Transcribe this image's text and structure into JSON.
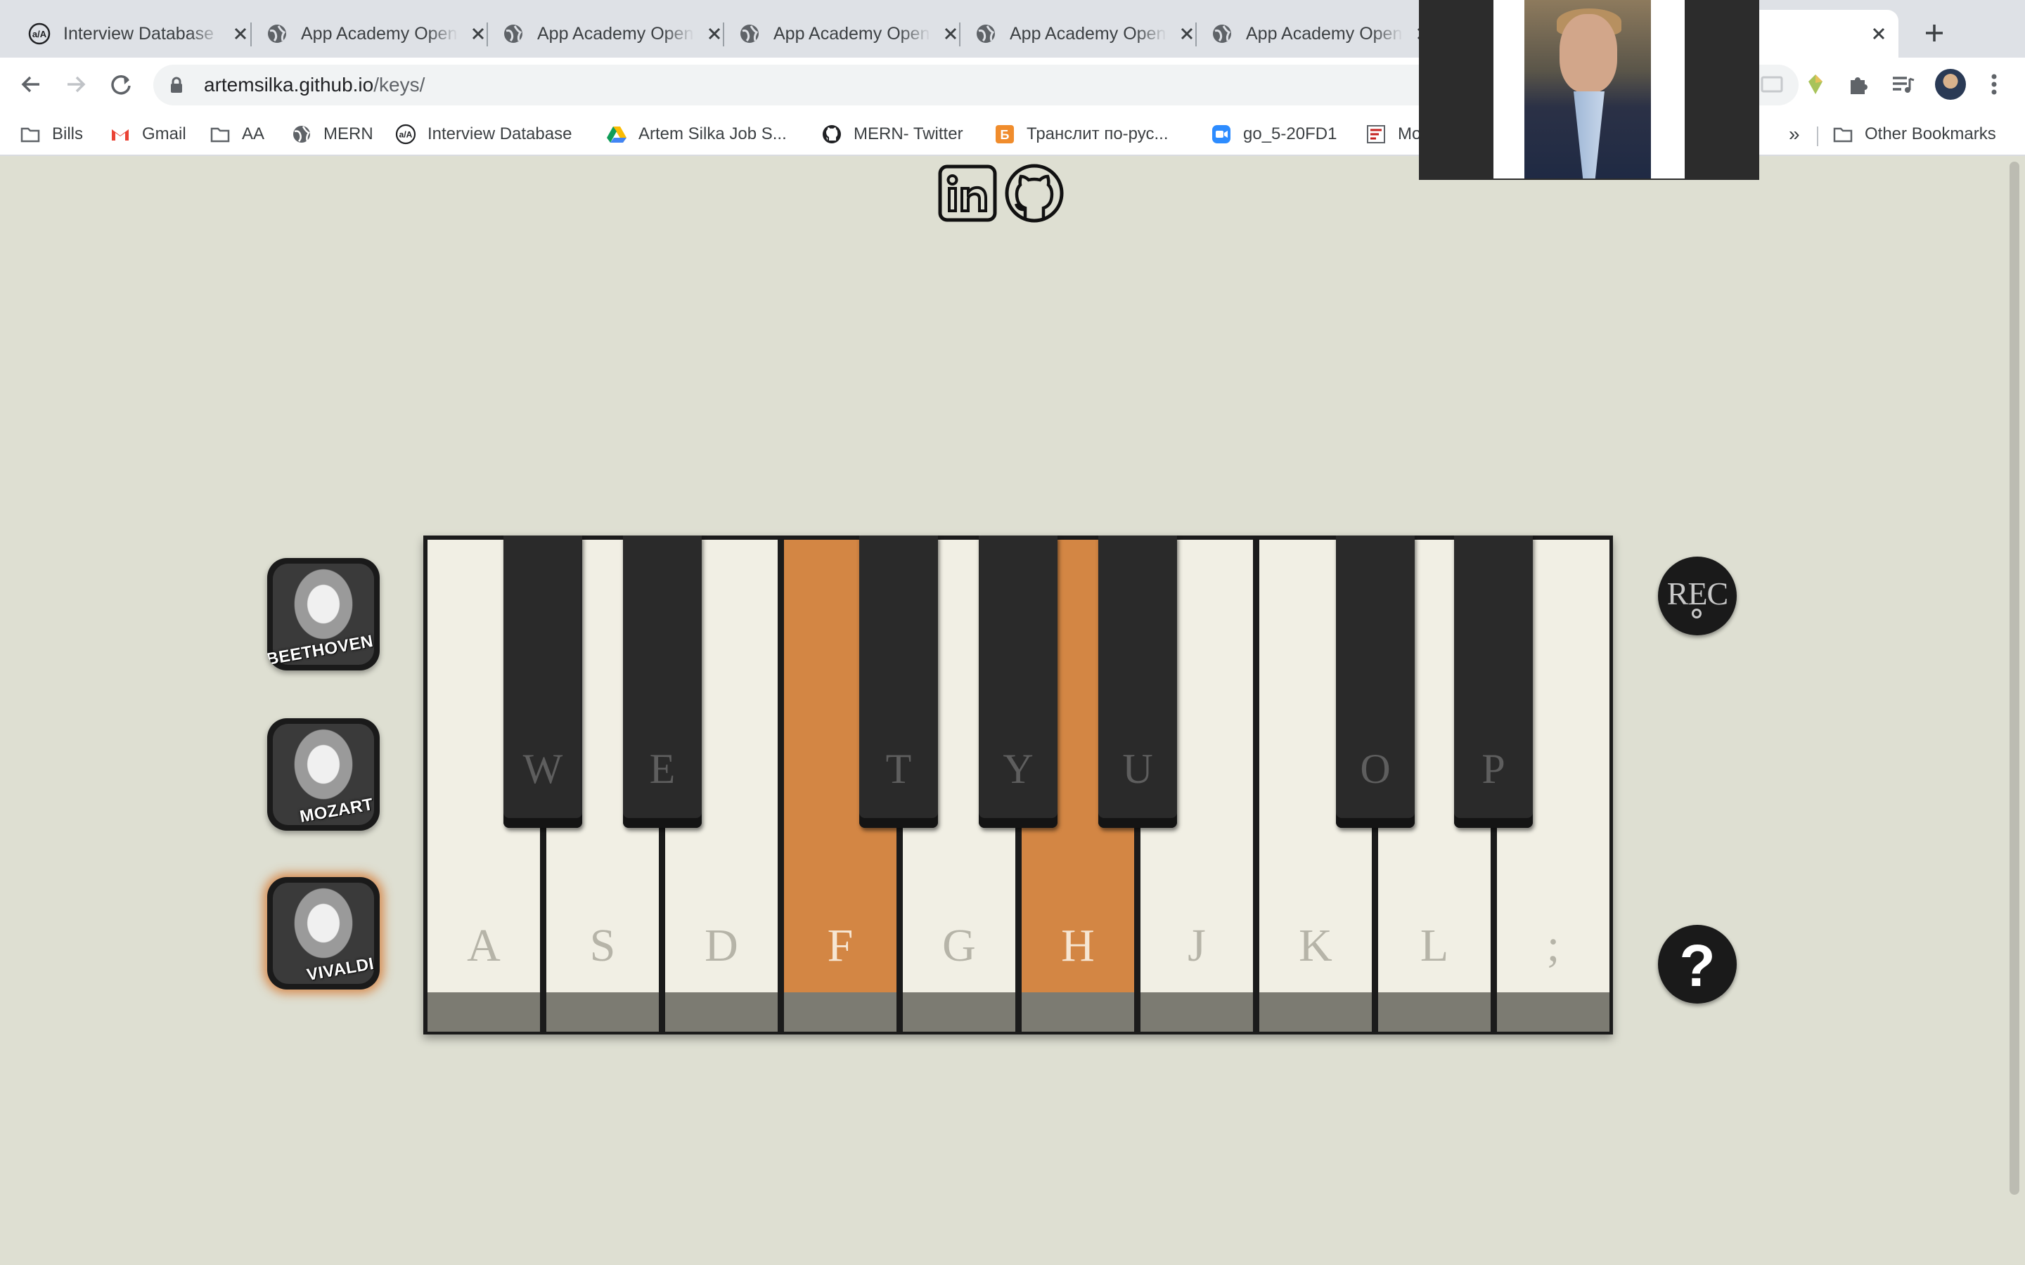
{
  "browser": {
    "tabs": [
      {
        "title": "Interview Database",
        "icon": "app-academy-icon",
        "active": false
      },
      {
        "title": "App Academy Open",
        "icon": "globe-icon",
        "active": false
      },
      {
        "title": "App Academy Open",
        "icon": "globe-icon",
        "active": false
      },
      {
        "title": "App Academy Open",
        "icon": "globe-icon",
        "active": false
      },
      {
        "title": "App Academy Open",
        "icon": "globe-icon",
        "active": false
      },
      {
        "title": "App Academy Open",
        "icon": "globe-icon",
        "active": false
      }
    ],
    "url_host": "artemsilka.github.io",
    "url_path": "/keys/",
    "bookmarks": [
      {
        "label": "Bills",
        "icon": "folder-icon"
      },
      {
        "label": "Gmail",
        "icon": "gmail-icon"
      },
      {
        "label": "AA",
        "icon": "folder-icon"
      },
      {
        "label": "MERN",
        "icon": "globe-icon"
      },
      {
        "label": "Interview Database",
        "icon": "app-academy-icon"
      },
      {
        "label": "Artem Silka Job S...",
        "icon": "google-drive-icon"
      },
      {
        "label": "MERN- Twitter",
        "icon": "github-icon"
      },
      {
        "label": "Транслит по-рус...",
        "icon": "translit-icon"
      },
      {
        "label": "go_5-20FD1",
        "icon": "zoom-icon"
      },
      {
        "label": "Mo",
        "icon": "bookmark-icon"
      }
    ],
    "overflow_label": "»",
    "other_bookmarks": "Other Bookmarks"
  },
  "page": {
    "social": [
      "linkedin-icon",
      "github-icon"
    ],
    "composers": [
      {
        "name": "BEETHOVEN",
        "selected": false
      },
      {
        "name": "MOZART",
        "selected": false
      },
      {
        "name": "VIVALDI",
        "selected": true
      }
    ],
    "white_keys": [
      {
        "label": "A",
        "active": false
      },
      {
        "label": "S",
        "active": false
      },
      {
        "label": "D",
        "active": false
      },
      {
        "label": "F",
        "active": true
      },
      {
        "label": "G",
        "active": false
      },
      {
        "label": "H",
        "active": true
      },
      {
        "label": "J",
        "active": false
      },
      {
        "label": "K",
        "active": false
      },
      {
        "label": "L",
        "active": false
      },
      {
        "label": ";",
        "active": false
      }
    ],
    "black_keys": [
      {
        "label": "W"
      },
      {
        "label": "E"
      },
      {
        "label": "T"
      },
      {
        "label": "Y"
      },
      {
        "label": "U"
      },
      {
        "label": "O"
      },
      {
        "label": "P"
      }
    ],
    "rec_label": "REC",
    "help_label": "?"
  },
  "colors": {
    "page_background": "#dedfd2",
    "active_key": "#d38644",
    "white_key": "#f1efe4",
    "black_key": "#2a2a2a",
    "selected_glow": "#d68242"
  }
}
